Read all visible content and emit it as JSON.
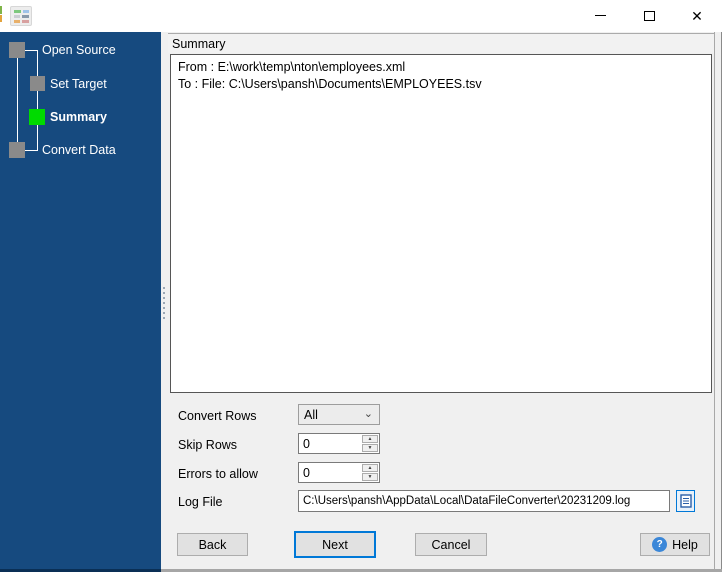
{
  "window": {
    "minimize_glyph": "",
    "maximize_glyph": "",
    "close_glyph": "✕"
  },
  "sidebar": {
    "steps": [
      {
        "label": "Open Source"
      },
      {
        "label": "Set Target"
      },
      {
        "label": "Summary"
      },
      {
        "label": "Convert Data"
      }
    ]
  },
  "panel": {
    "caption": "Summary",
    "summary": {
      "line1": "From : E:\\work\\temp\\nton\\employees.xml",
      "line2": "To : File: C:\\Users\\pansh\\Documents\\EMPLOYEES.tsv"
    }
  },
  "form": {
    "convert_rows_label": "Convert Rows",
    "convert_rows_value": "All",
    "skip_rows_label": "Skip Rows",
    "skip_rows_value": "0",
    "errors_label": "Errors to allow",
    "errors_value": "0",
    "log_file_label": "Log File",
    "log_file_value": "C:\\Users\\pansh\\AppData\\Local\\DataFileConverter\\20231209.log"
  },
  "buttons": {
    "back": "Back",
    "next": "Next",
    "cancel": "Cancel",
    "help": "Help"
  },
  "colors": {
    "sidebar_blue": "#164a7f",
    "active_step_green": "#00db00",
    "step_gray": "#8a8a8a",
    "accent_blue": "#0078d7"
  }
}
